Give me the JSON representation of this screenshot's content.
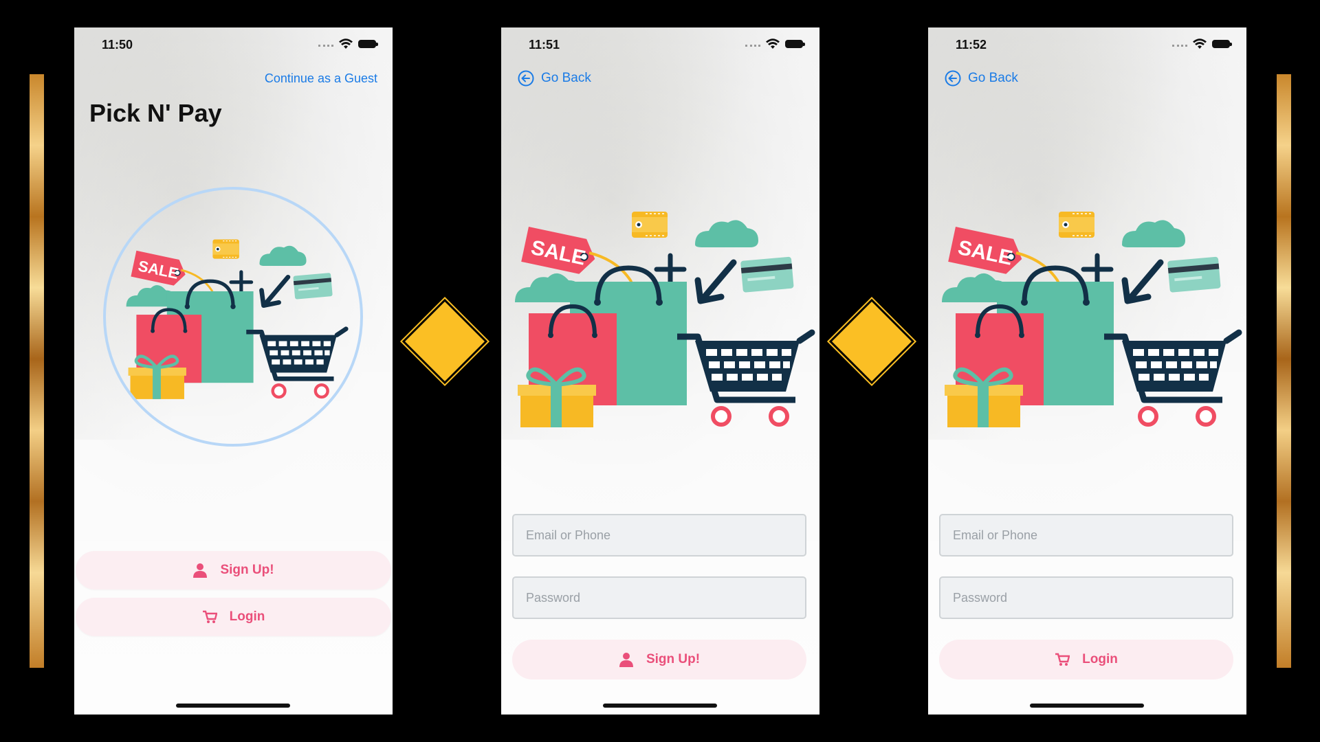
{
  "screens": [
    {
      "time": "11:50",
      "guest_link": "Continue as a Guest",
      "title": "Pick N' Pay",
      "buttons": [
        {
          "label": "Sign Up!",
          "icon": "person-icon"
        },
        {
          "label": "Login",
          "icon": "cart-icon"
        }
      ]
    },
    {
      "time": "11:51",
      "back_label": "Go Back",
      "fields": [
        {
          "placeholder": "Email or Phone"
        },
        {
          "placeholder": "Password"
        }
      ],
      "button": {
        "label": "Sign Up!",
        "icon": "person-icon"
      }
    },
    {
      "time": "11:52",
      "back_label": "Go Back",
      "fields": [
        {
          "placeholder": "Email or Phone"
        },
        {
          "placeholder": "Password"
        }
      ],
      "button": {
        "label": "Login",
        "icon": "cart-icon"
      }
    }
  ],
  "illustration": {
    "sale_tag": "SALE"
  },
  "colors": {
    "link_blue": "#1a7be6",
    "accent_pink": "#ea4f7a",
    "bag_teal": "#5dbfa6",
    "bag_red": "#f04d63",
    "gift_yellow": "#f7b924",
    "cart_navy": "#123047",
    "divider_gold": "#fbbf24"
  }
}
